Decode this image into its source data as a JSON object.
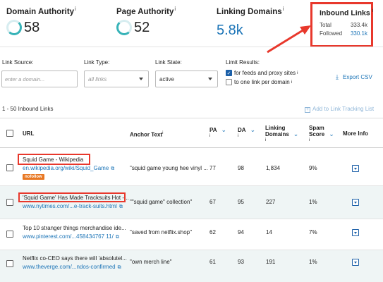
{
  "metrics": {
    "domain_authority": {
      "label": "Domain Authority",
      "info": "i",
      "value": "58"
    },
    "page_authority": {
      "label": "Page Authority",
      "info": "i",
      "value": "52"
    },
    "linking_domains": {
      "label": "Linking Domains",
      "info": "i",
      "value": "5.8k"
    },
    "inbound_links": {
      "label": "Inbound Links",
      "info": "i",
      "total_label": "Total",
      "total_value": "333.4k",
      "followed_label": "Followed",
      "followed_value": "330.1k"
    }
  },
  "filters": {
    "link_source": {
      "label": "Link Source:",
      "placeholder": "enter a domain..."
    },
    "link_type": {
      "label": "Link Type:",
      "value": "all links"
    },
    "link_state": {
      "label": "Link State:",
      "value": "active"
    },
    "limit_results": {
      "label": "Limit Results:",
      "option1": "for feeds and proxy sites",
      "option1_checked": true,
      "option2": "to one link per domain",
      "option2_checked": false,
      "info": "i"
    },
    "export_label": "Export CSV"
  },
  "results": {
    "count": "1 - 50  Inbound Links",
    "add_tracking": "Add to Link Tracking List"
  },
  "table": {
    "headers": {
      "url": "URL",
      "anchor": "Anchor Text",
      "anchor_info": "i",
      "pa": "PA",
      "pa_info": "i",
      "da": "DA",
      "da_info": "i",
      "linking_domains_1": "Linking",
      "linking_domains_2": "Domains",
      "linking_domains_info": "i",
      "spam_1": "Spam",
      "spam_2": "Score",
      "spam_info": "i",
      "more": "More Info"
    },
    "rows": [
      {
        "title": "Squid Game - Wikipedia",
        "url": "en.wikipedia.org/wiki/Squid_Game",
        "badge": "nofollow",
        "anchor": "\"squid game young hee vinyl ...",
        "pa": "77",
        "da": "98",
        "ld": "1,834",
        "spam": "9%"
      },
      {
        "title": "'Squid Game' Has Made Tracksuits Hot -...",
        "url": "www.nytimes.com/...e-track-suits.html",
        "anchor": "\"\"squid game\" collection\"",
        "pa": "67",
        "da": "95",
        "ld": "227",
        "spam": "1%"
      },
      {
        "title": "Top 10 stranger things merchandise ide...",
        "url": "www.pinterest.com/...458434767 11/",
        "anchor": "\"saved from netflix.shop\"",
        "pa": "62",
        "da": "94",
        "ld": "14",
        "spam": "7%"
      },
      {
        "title": "Netflix co-CEO says there will 'absolutel...",
        "url": "www.theverge.com/...ndos-confirmed",
        "anchor": "\"own merch line\"",
        "pa": "61",
        "da": "93",
        "ld": "191",
        "spam": "1%"
      }
    ]
  },
  "colors": {
    "highlight": "#e8382c",
    "link": "#1b74b7",
    "accent": "#37b3b8",
    "badge": "#e87722"
  }
}
